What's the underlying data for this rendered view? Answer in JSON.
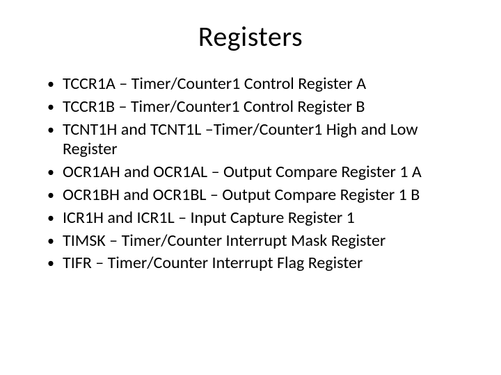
{
  "title": "Registers",
  "bullets": [
    "TCCR1A – Timer/Counter1 Control Register A",
    "TCCR1B – Timer/Counter1 Control Register B",
    "TCNT1H and TCNT1L –Timer/Counter1 High and Low Register",
    "OCR1AH and OCR1AL – Output Compare Register 1 A",
    "OCR1BH and OCR1BL – Output Compare Register 1 B",
    "ICR1H and ICR1L – Input Capture Register 1",
    "TIMSK – Timer/Counter Interrupt Mask Register",
    "TIFR – Timer/Counter Interrupt Flag Register"
  ]
}
